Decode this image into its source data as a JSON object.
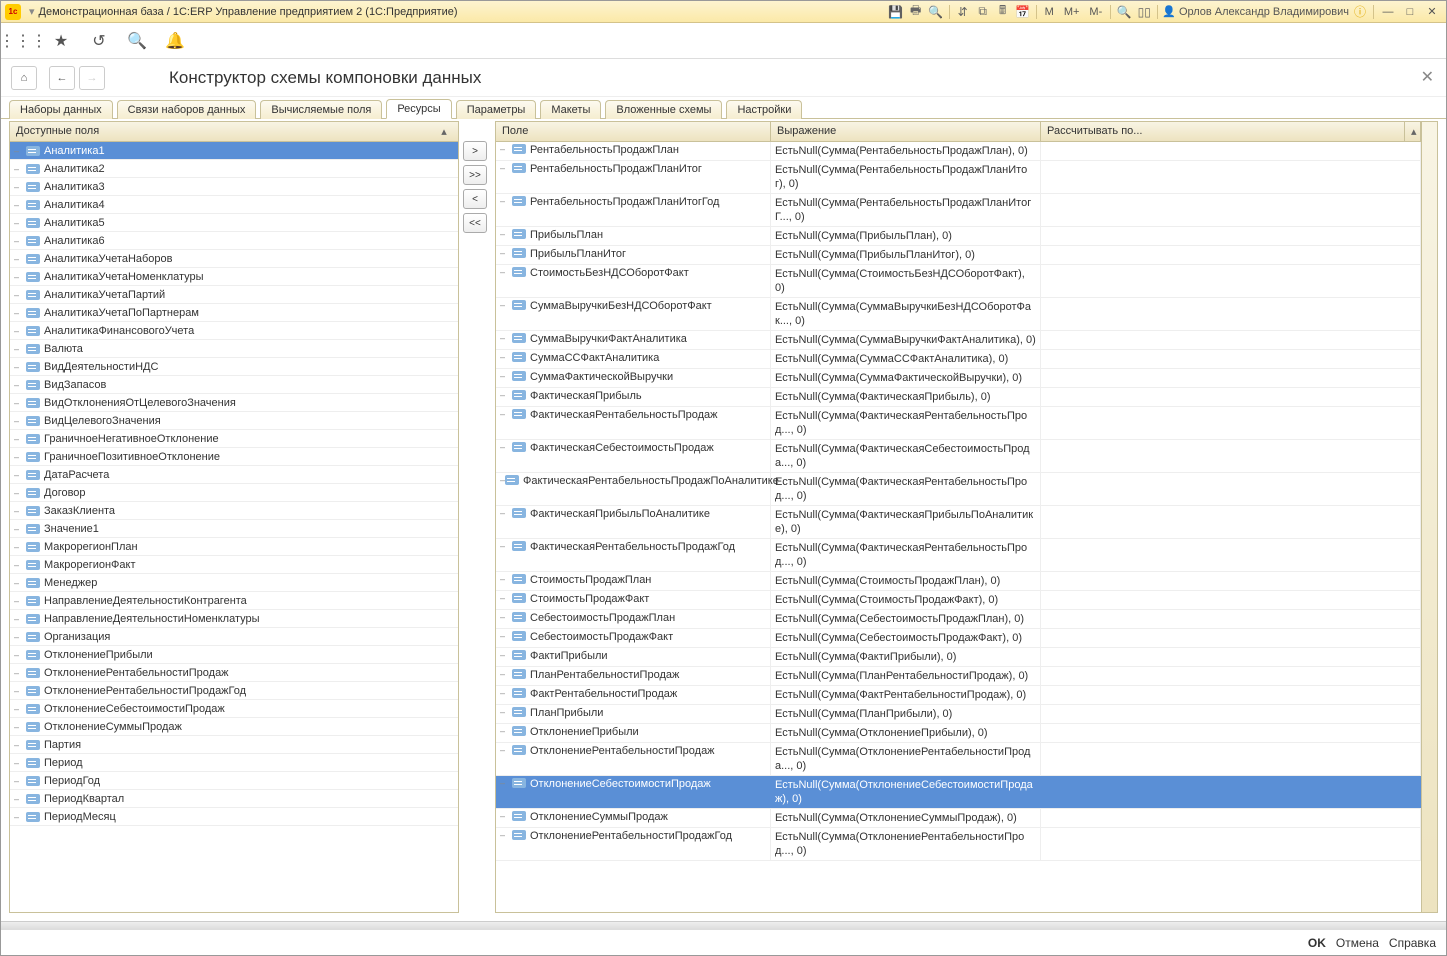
{
  "titlebar": {
    "title": "Демонстрационная база / 1С:ERP Управление предприятием 2  (1С:Предприятие)",
    "user": "Орлов Александр Владимирович",
    "m_label": "M",
    "mplus_label": "M+",
    "mminus_label": "M-"
  },
  "header": {
    "page_title": "Конструктор схемы компоновки данных"
  },
  "tabs": [
    {
      "label": "Наборы данных"
    },
    {
      "label": "Связи наборов данных"
    },
    {
      "label": "Вычисляемые поля"
    },
    {
      "label": "Ресурсы"
    },
    {
      "label": "Параметры"
    },
    {
      "label": "Макеты"
    },
    {
      "label": "Вложенные схемы"
    },
    {
      "label": "Настройки"
    }
  ],
  "active_tab_index": 3,
  "left_panel": {
    "header": "Доступные поля",
    "selected_index": 0,
    "fields": [
      "Аналитика1",
      "Аналитика2",
      "Аналитика3",
      "Аналитика4",
      "Аналитика5",
      "Аналитика6",
      "АналитикаУчетаНаборов",
      "АналитикаУчетаНоменклатуры",
      "АналитикаУчетаПартий",
      "АналитикаУчетаПоПартнерам",
      "АналитикаФинансовогоУчета",
      "Валюта",
      "ВидДеятельностиНДС",
      "ВидЗапасов",
      "ВидОтклоненияОтЦелевогоЗначения",
      "ВидЦелевогоЗначения",
      "ГраничноеНегативноеОтклонение",
      "ГраничноеПозитивноеОтклонение",
      "ДатаРасчета",
      "Договор",
      "ЗаказКлиента",
      "Значение1",
      "МакрорегионПлан",
      "МакрорегионФакт",
      "Менеджер",
      "НаправлениеДеятельностиКонтрагента",
      "НаправлениеДеятельностиНоменклатуры",
      "Организация",
      "ОтклонениеПрибыли",
      "ОтклонениеРентабельностиПродаж",
      "ОтклонениеРентабельностиПродажГод",
      "ОтклонениеСебестоимостиПродаж",
      "ОтклонениеСуммыПродаж",
      "Партия",
      "Период",
      "ПериодГод",
      "ПериодКвартал",
      "ПериодМесяц"
    ]
  },
  "mid_buttons": {
    "add": ">",
    "add_all": ">>",
    "remove": "<",
    "remove_all": "<<"
  },
  "right_panel": {
    "col_field": "Поле",
    "col_expr": "Выражение",
    "col_calc": "Рассчитывать по...",
    "selected_index": 26,
    "rows": [
      {
        "field": "РентабельностьПродажПлан",
        "expr": "ЕстьNull(Сумма(РентабельностьПродажПлан), 0)"
      },
      {
        "field": "РентабельностьПродажПланИтог",
        "expr": "ЕстьNull(Сумма(РентабельностьПродажПланИтог), 0)"
      },
      {
        "field": "РентабельностьПродажПланИтогГод",
        "expr": "ЕстьNull(Сумма(РентабельностьПродажПланИтогГ..., 0)"
      },
      {
        "field": "ПрибыльПлан",
        "expr": "ЕстьNull(Сумма(ПрибыльПлан), 0)"
      },
      {
        "field": "ПрибыльПланИтог",
        "expr": "ЕстьNull(Сумма(ПрибыльПланИтог), 0)"
      },
      {
        "field": "СтоимостьБезНДСОборотФакт",
        "expr": "ЕстьNull(Сумма(СтоимостьБезНДСОборотФакт), 0)"
      },
      {
        "field": "СуммаВыручкиБезНДСОборотФакт",
        "expr": "ЕстьNull(Сумма(СуммаВыручкиБезНДСОборотФак..., 0)"
      },
      {
        "field": "СуммаВыручкиФактАналитика",
        "expr": "ЕстьNull(Сумма(СуммаВыручкиФактАналитика), 0)"
      },
      {
        "field": "СуммаССФактАналитика",
        "expr": "ЕстьNull(Сумма(СуммаССФактАналитика), 0)"
      },
      {
        "field": "СуммаФактическойВыручки",
        "expr": "ЕстьNull(Сумма(СуммаФактическойВыручки), 0)"
      },
      {
        "field": "ФактическаяПрибыль",
        "expr": "ЕстьNull(Сумма(ФактическаяПрибыль), 0)"
      },
      {
        "field": "ФактическаяРентабельностьПродаж",
        "expr": "ЕстьNull(Сумма(ФактическаяРентабельностьПрод..., 0)"
      },
      {
        "field": "ФактическаяСебестоимостьПродаж",
        "expr": "ЕстьNull(Сумма(ФактическаяСебестоимостьПрода..., 0)"
      },
      {
        "field": "ФактическаяРентабельностьПродажПоАналитике",
        "expr": "ЕстьNull(Сумма(ФактическаяРентабельностьПрод..., 0)"
      },
      {
        "field": "ФактическаяПрибыльПоАналитике",
        "expr": "ЕстьNull(Сумма(ФактическаяПрибыльПоАналитике), 0)"
      },
      {
        "field": "ФактическаяРентабельностьПродажГод",
        "expr": "ЕстьNull(Сумма(ФактическаяРентабельностьПрод..., 0)"
      },
      {
        "field": "СтоимостьПродажПлан",
        "expr": "ЕстьNull(Сумма(СтоимостьПродажПлан), 0)"
      },
      {
        "field": "СтоимостьПродажФакт",
        "expr": "ЕстьNull(Сумма(СтоимостьПродажФакт), 0)"
      },
      {
        "field": "СебестоимостьПродажПлан",
        "expr": "ЕстьNull(Сумма(СебестоимостьПродажПлан), 0)"
      },
      {
        "field": "СебестоимостьПродажФакт",
        "expr": "ЕстьNull(Сумма(СебестоимостьПродажФакт), 0)"
      },
      {
        "field": "ФактиПрибыли",
        "expr": "ЕстьNull(Сумма(ФактиПрибыли), 0)"
      },
      {
        "field": "ПланРентабельностиПродаж",
        "expr": "ЕстьNull(Сумма(ПланРентабельностиПродаж), 0)"
      },
      {
        "field": "ФактРентабельностиПродаж",
        "expr": "ЕстьNull(Сумма(ФактРентабельностиПродаж), 0)"
      },
      {
        "field": "ПланПрибыли",
        "expr": "ЕстьNull(Сумма(ПланПрибыли), 0)"
      },
      {
        "field": "ОтклонениеПрибыли",
        "expr": "ЕстьNull(Сумма(ОтклонениеПрибыли), 0)"
      },
      {
        "field": "ОтклонениеРентабельностиПродаж",
        "expr": "ЕстьNull(Сумма(ОтклонениеРентабельностиПрода..., 0)"
      },
      {
        "field": "ОтклонениеСебестоимостиПродаж",
        "expr": "ЕстьNull(Сумма(ОтклонениеСебестоимостиПродаж), 0)"
      },
      {
        "field": "ОтклонениеСуммыПродаж",
        "expr": "ЕстьNull(Сумма(ОтклонениеСуммыПродаж), 0)"
      },
      {
        "field": "ОтклонениеРентабельностиПродажГод",
        "expr": "ЕстьNull(Сумма(ОтклонениеРентабельностиПрод..., 0)"
      }
    ]
  },
  "footer": {
    "ok": "OK",
    "cancel": "Отмена",
    "help": "Справка"
  }
}
